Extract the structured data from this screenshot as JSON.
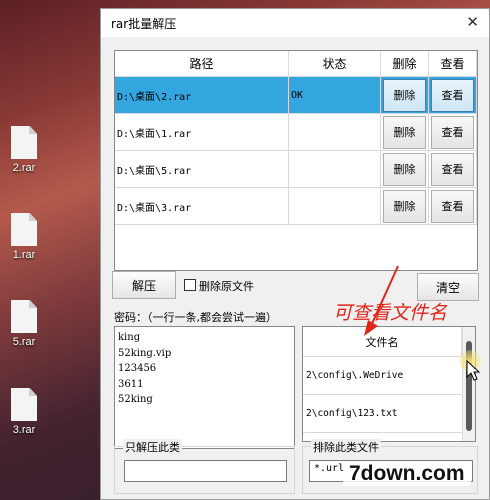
{
  "desktop": {
    "icons": [
      {
        "label": "2.rar",
        "icon": "file-icon"
      },
      {
        "label": "1.rar",
        "icon": "file-icon"
      },
      {
        "label": "5.rar",
        "icon": "file-icon"
      },
      {
        "label": "3.rar",
        "icon": "file-icon"
      }
    ]
  },
  "window": {
    "title": "rar批量解压",
    "close_glyph": "✕"
  },
  "grid": {
    "headers": [
      "路径",
      "状态",
      "删除",
      "查看"
    ],
    "rows": [
      {
        "path": "D:\\桌面\\2.rar",
        "status": "OK",
        "delete": "删除",
        "view": "查看"
      },
      {
        "path": "D:\\桌面\\1.rar",
        "status": "",
        "delete": "删除",
        "view": "查看"
      },
      {
        "path": "D:\\桌面\\5.rar",
        "status": "",
        "delete": "删除",
        "view": "查看"
      },
      {
        "path": "D:\\桌面\\3.rar",
        "status": "",
        "delete": "删除",
        "view": "查看"
      }
    ]
  },
  "controls": {
    "extract_button": "解压",
    "delete_original_label": "删除原文件",
    "clear_button": "清空",
    "password_label": "密码：（一行一条,都会尝试一遍）"
  },
  "passwords": [
    "king",
    "52king.vip",
    "123456",
    "3611",
    "52king"
  ],
  "file_list": {
    "header": "文件名",
    "items": [
      "2\\config\\.WeDrive",
      "2\\config\\123.txt"
    ]
  },
  "groups": {
    "only_extract_title": "只解压此类",
    "only_extract_value": "",
    "exclude_title": "排除此类文件",
    "exclude_value": "*.url"
  },
  "annotation": "可查看文件名",
  "watermark": "7down.com",
  "colors": {
    "selected_row": "#34a6df",
    "annotation": "#e0261c"
  }
}
